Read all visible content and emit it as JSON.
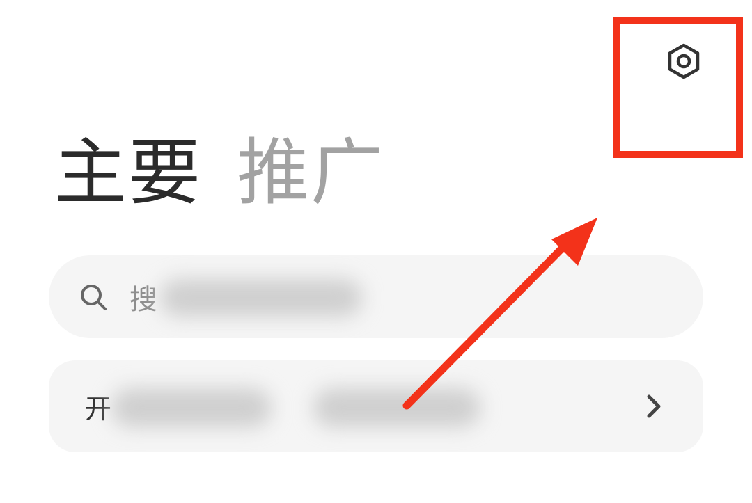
{
  "header": {
    "settings_icon": "gear-icon"
  },
  "tabs": [
    {
      "label": "主要",
      "active": true
    },
    {
      "label": "推广",
      "active": false
    }
  ],
  "search": {
    "icon": "search-icon",
    "placeholder_visible": "搜"
  },
  "open_row": {
    "label_visible": "开",
    "chevron_icon": "chevron-right-icon"
  },
  "annotation": {
    "color": "#f3321a"
  },
  "colors": {
    "active_tab": "#2b2b2b",
    "inactive_tab": "#a2a2a2",
    "card_bg": "#f5f5f5",
    "icon": "#333333"
  }
}
